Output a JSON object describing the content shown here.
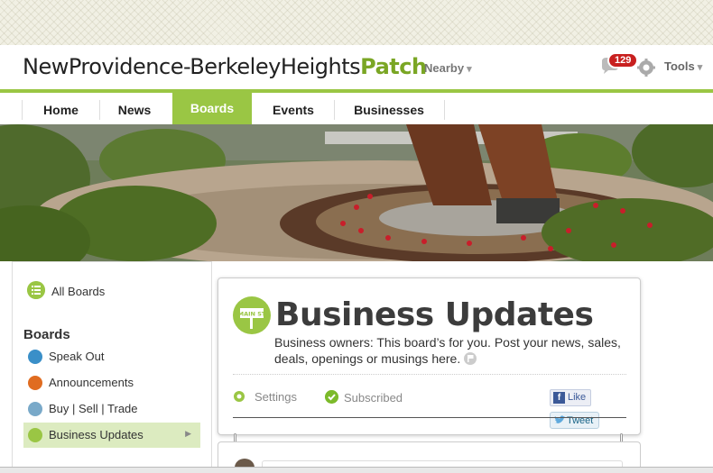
{
  "header": {
    "site_name": "NewProvidence-BerkeleyHeights",
    "brand": "Patch",
    "nearby_label": "Nearby",
    "notification_count": "129",
    "tools_label": "Tools"
  },
  "nav": {
    "items": [
      "Home",
      "News",
      "Boards",
      "Events",
      "Businesses"
    ],
    "active": "Boards"
  },
  "sidebar": {
    "all_boards_label": "All Boards",
    "heading": "Boards",
    "items": [
      {
        "label": "Speak Out",
        "icon": "speech-icon",
        "color": "#3a8fc8"
      },
      {
        "label": "Announcements",
        "icon": "megaphone-icon",
        "color": "#e06c20"
      },
      {
        "label": "Buy | Sell | Trade",
        "icon": "tag-icon",
        "color": "#79a9c9"
      },
      {
        "label": "Business Updates",
        "icon": "main-st-icon",
        "color": "#9ac644"
      }
    ]
  },
  "board": {
    "title": "Business Updates",
    "description": "Business owners: This board’s for you. Post your news, sales, deals, openings or musings here.",
    "icon_text": "MAIN ST",
    "settings_label": "Settings",
    "subscribed_label": "Subscribed",
    "like_label": "Like",
    "tweet_label": "Tweet"
  },
  "colors": {
    "brand_green": "#9ac644",
    "badge_red": "#c8201f"
  }
}
